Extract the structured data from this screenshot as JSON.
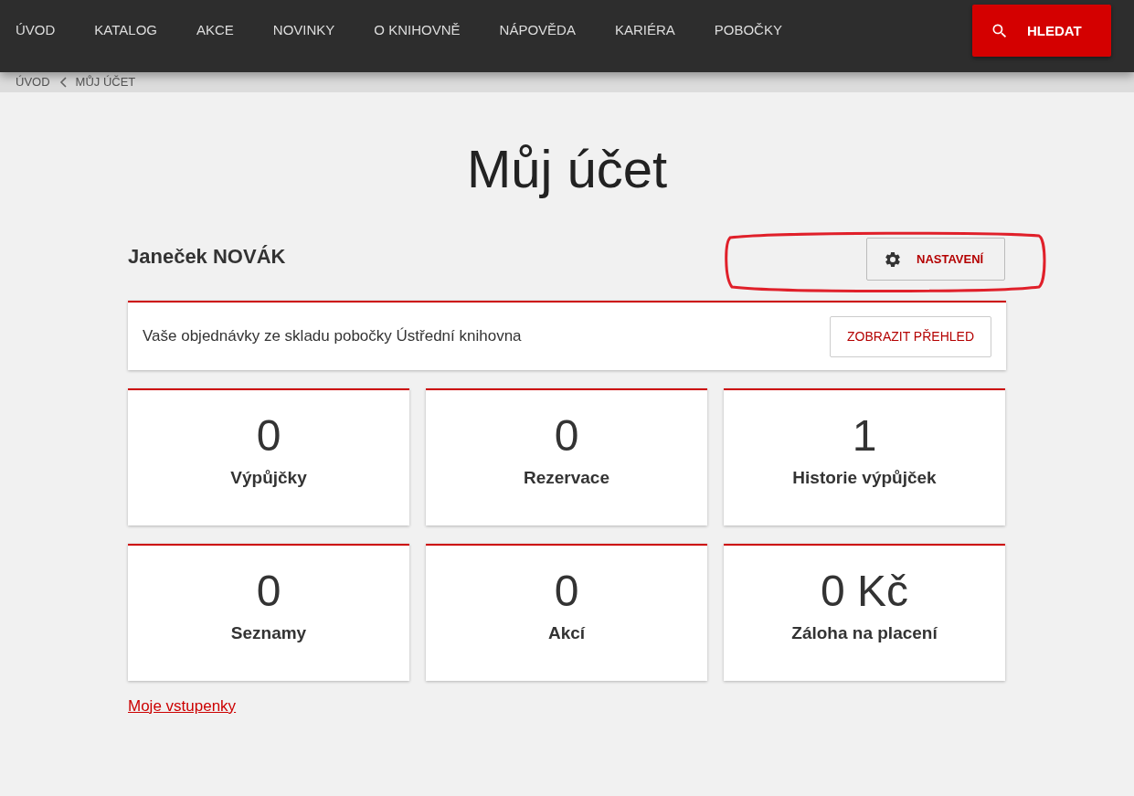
{
  "nav": {
    "items": [
      {
        "label": "ÚVOD"
      },
      {
        "label": "KATALOG"
      },
      {
        "label": "AKCE"
      },
      {
        "label": "NOVINKY"
      },
      {
        "label": "O KNIHOVNĚ"
      },
      {
        "label": "NÁPOVĚDA"
      },
      {
        "label": "KARIÉRA"
      },
      {
        "label": "POBOČKY"
      }
    ],
    "search_button": "HLEDAT"
  },
  "breadcrumb": [
    "ÚVOD",
    "MŮJ ÚČET"
  ],
  "title": "Můj účet",
  "user_name": "Janeček NOVÁK",
  "settings_button": {
    "label": "NASTAVENÍ",
    "highlighted": true
  },
  "orders": {
    "text": "Vaše objednávky ze skladu pobočky Ústřední knihovna",
    "button": "ZOBRAZIT PŘEHLED"
  },
  "stats": [
    {
      "value": "0",
      "label": "Výpůjčky"
    },
    {
      "value": "0",
      "label": "Rezervace"
    },
    {
      "value": "1",
      "label": "Historie výpůjček"
    },
    {
      "value": "0",
      "label": "Seznamy"
    },
    {
      "value": "0",
      "label": "Akcí"
    },
    {
      "value": "0 Kč",
      "label": "Záloha na placení"
    }
  ],
  "tickets_link": "Moje vstupenky"
}
